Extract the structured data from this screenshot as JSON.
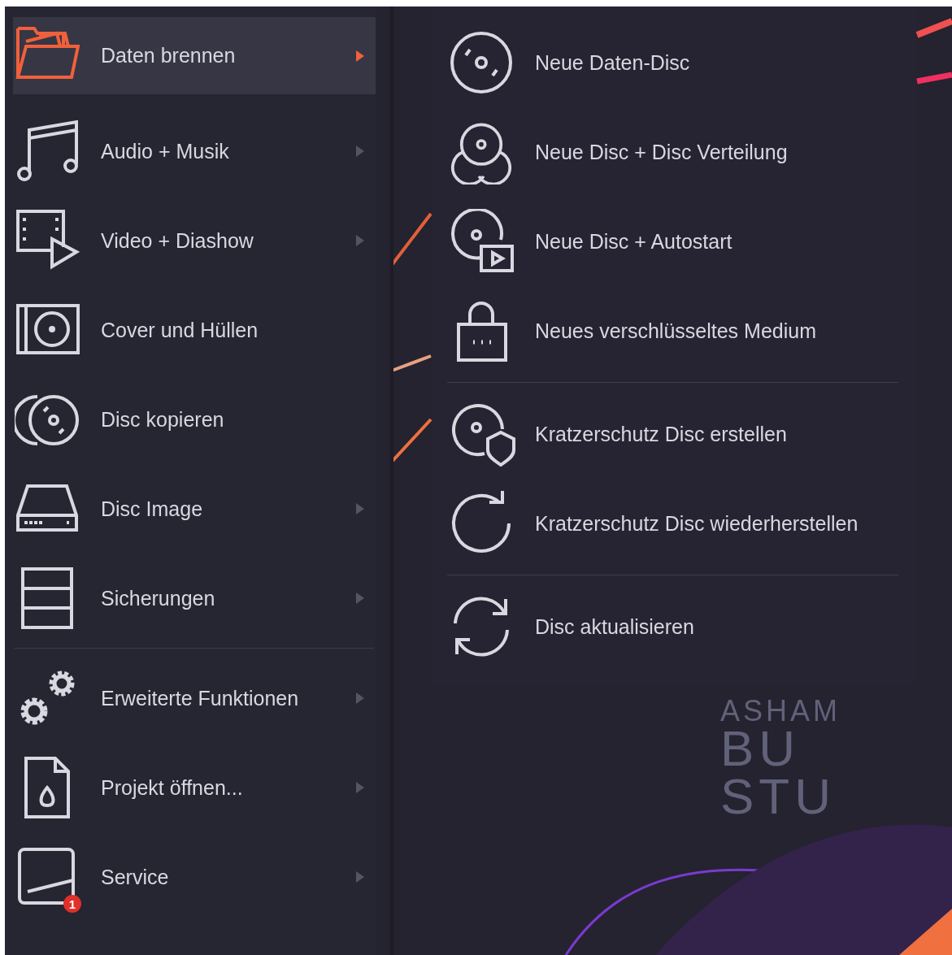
{
  "menu": {
    "items": [
      {
        "label": "Daten brennen",
        "selected": true,
        "has_submenu": true,
        "separator_before": false
      },
      {
        "label": "Audio + Musik",
        "selected": false,
        "has_submenu": true,
        "separator_before": false
      },
      {
        "label": "Video + Diashow",
        "selected": false,
        "has_submenu": true,
        "separator_before": false
      },
      {
        "label": "Cover und Hüllen",
        "selected": false,
        "has_submenu": false,
        "separator_before": false
      },
      {
        "label": "Disc kopieren",
        "selected": false,
        "has_submenu": false,
        "separator_before": false
      },
      {
        "label": "Disc Image",
        "selected": false,
        "has_submenu": true,
        "separator_before": false
      },
      {
        "label": "Sicherungen",
        "selected": false,
        "has_submenu": true,
        "separator_before": false
      },
      {
        "label": "Erweiterte Funktionen",
        "selected": false,
        "has_submenu": true,
        "separator_before": true
      },
      {
        "label": "Projekt öffnen...",
        "selected": false,
        "has_submenu": true,
        "separator_before": false
      },
      {
        "label": "Service",
        "selected": false,
        "has_submenu": true,
        "separator_before": false,
        "badge": "1"
      }
    ]
  },
  "submenu": {
    "groups": [
      [
        {
          "label": "Neue Daten-Disc"
        },
        {
          "label": "Neue Disc + Disc Verteilung"
        },
        {
          "label": "Neue Disc + Autostart"
        },
        {
          "label": "Neues verschlüsseltes Medium"
        }
      ],
      [
        {
          "label": "Kratzerschutz Disc erstellen"
        },
        {
          "label": "Kratzerschutz Disc wiederherstellen"
        }
      ],
      [
        {
          "label": "Disc aktualisieren"
        }
      ]
    ]
  },
  "splash": {
    "lines": [
      "ASHAM",
      "BU",
      "STU"
    ]
  }
}
